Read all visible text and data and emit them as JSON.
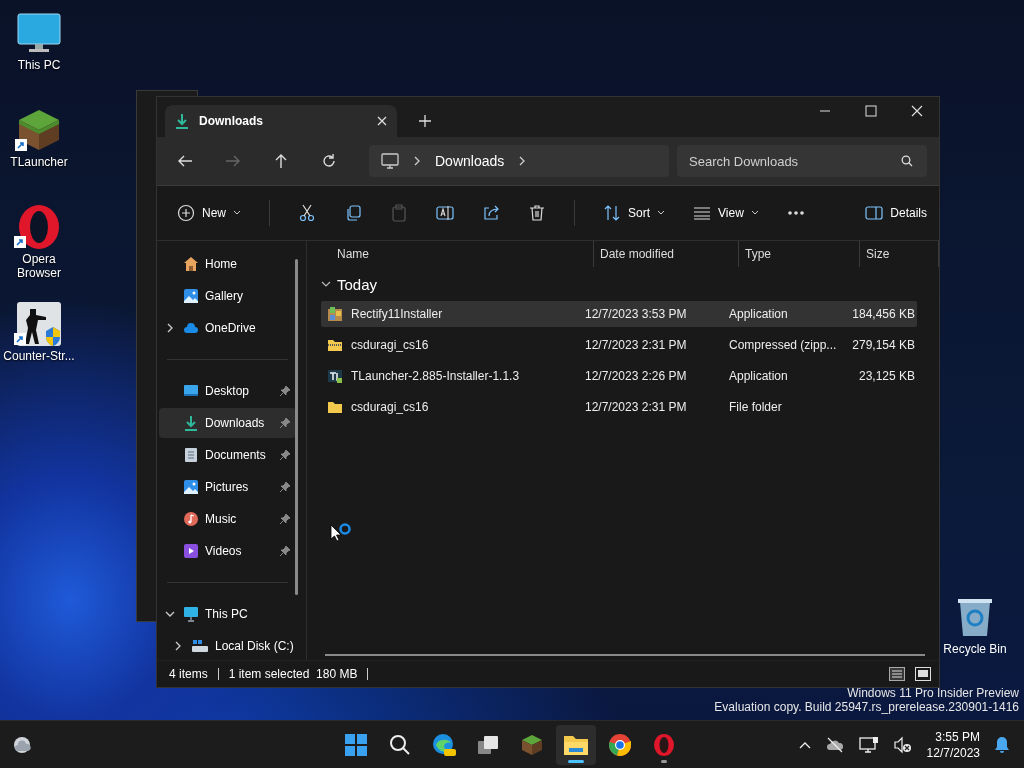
{
  "desktop": {
    "icons": [
      {
        "label": "This PC",
        "kind": "pc",
        "shortcut": false
      },
      {
        "label": "TLauncher",
        "kind": "grass",
        "shortcut": true
      },
      {
        "label": "Opera Browser",
        "kind": "opera",
        "shortcut": true
      },
      {
        "label": "Counter-Str...",
        "kind": "soldier",
        "shortcut": true
      }
    ],
    "recycle_bin": {
      "label": "Recycle Bin"
    },
    "watermark": [
      "Windows 11 Pro Insider Preview",
      "Evaluation copy. Build 25947.rs_prerelease.230901-1416"
    ]
  },
  "explorer": {
    "tab": {
      "title": "Downloads"
    },
    "address": {
      "segments": [
        "Downloads"
      ]
    },
    "search": {
      "placeholder": "Search Downloads"
    },
    "toolbar": {
      "new": "New",
      "sort": "Sort",
      "view": "View",
      "details": "Details"
    },
    "sidebar": {
      "groups": [
        {
          "items": [
            {
              "label": "Home",
              "kind": "home"
            },
            {
              "label": "Gallery",
              "kind": "gallery"
            },
            {
              "label": "OneDrive",
              "kind": "cloud",
              "expanded": false
            }
          ]
        },
        {
          "items": [
            {
              "label": "Desktop",
              "kind": "desktop",
              "pinned": true,
              "selected": false
            },
            {
              "label": "Downloads",
              "kind": "download",
              "pinned": true,
              "selected": true
            },
            {
              "label": "Documents",
              "kind": "document",
              "pinned": true,
              "selected": false
            },
            {
              "label": "Pictures",
              "kind": "gallery",
              "pinned": true,
              "selected": false
            },
            {
              "label": "Music",
              "kind": "music",
              "pinned": true,
              "selected": false
            },
            {
              "label": "Videos",
              "kind": "video",
              "pinned": true,
              "selected": false
            }
          ]
        },
        {
          "items": [
            {
              "label": "This PC",
              "kind": "pc",
              "expanded": true,
              "children": [
                {
                  "label": "Local Disk (C:)",
                  "kind": "disk",
                  "expanded": false
                }
              ]
            }
          ]
        }
      ]
    },
    "columns": [
      "Name",
      "Date modified",
      "Type",
      "Size"
    ],
    "group": {
      "label": "Today",
      "expanded": true
    },
    "rows": [
      {
        "name": "Rectify11Installer",
        "kind": "installer",
        "date": "12/7/2023 3:53 PM",
        "type": "Application",
        "size": "184,456 KB",
        "selected": true
      },
      {
        "name": "csduragi_cs16",
        "kind": "zip",
        "date": "12/7/2023 2:31 PM",
        "type": "Compressed (zipp...",
        "size": "279,154 KB",
        "selected": false
      },
      {
        "name": "TLauncher-2.885-Installer-1.1.3",
        "kind": "tl",
        "date": "12/7/2023 2:26 PM",
        "type": "Application",
        "size": "23,125 KB",
        "selected": false
      },
      {
        "name": "csduragi_cs16",
        "kind": "folder",
        "date": "12/7/2023 2:31 PM",
        "type": "File folder",
        "selected": false
      }
    ],
    "status": {
      "count": "4 items",
      "selection": "1 item selected  180 MB"
    }
  },
  "taskbar": {
    "apps": [
      {
        "kind": "start",
        "open": false,
        "focused": false
      },
      {
        "kind": "search",
        "open": false,
        "focused": false
      },
      {
        "kind": "edge",
        "open": false,
        "focused": false
      },
      {
        "kind": "taskview",
        "open": false,
        "focused": false
      },
      {
        "kind": "grass",
        "open": false,
        "focused": false
      },
      {
        "kind": "folder",
        "open": true,
        "focused": true
      },
      {
        "kind": "chrome",
        "open": false,
        "focused": false
      },
      {
        "kind": "opera",
        "open": true,
        "focused": false
      }
    ],
    "time": "3:55 PM",
    "date": "12/7/2023"
  }
}
